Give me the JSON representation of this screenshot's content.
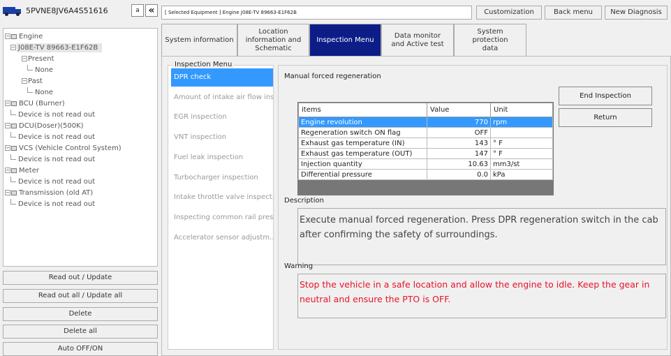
{
  "vehicle": {
    "vin": "5PVNE8JV6A4S51616",
    "btn_small": "a",
    "btn_collapse": "«"
  },
  "tree": [
    {
      "label": "Engine",
      "type": "root"
    },
    {
      "label": "J08E-TV 89663-E1F62B",
      "type": "ecu",
      "selected": true
    },
    {
      "label": "Present",
      "type": "group"
    },
    {
      "label": "None",
      "type": "leaf2"
    },
    {
      "label": "Past",
      "type": "group"
    },
    {
      "label": "None",
      "type": "leaf2"
    },
    {
      "label": "BCU (Burner)",
      "type": "root"
    },
    {
      "label": "Device is not read out",
      "type": "leaf"
    },
    {
      "label": "DCU(Doser)(500K)",
      "type": "root"
    },
    {
      "label": "Device is not read out",
      "type": "leaf"
    },
    {
      "label": "VCS (Vehicle Control System)",
      "type": "root"
    },
    {
      "label": "Device is not read out",
      "type": "leaf"
    },
    {
      "label": "Meter",
      "type": "root"
    },
    {
      "label": "Device is not read out",
      "type": "leaf"
    },
    {
      "label": "Transmission (old AT)",
      "type": "root"
    },
    {
      "label": "Device is not read out",
      "type": "leaf"
    }
  ],
  "left_buttons": {
    "read_out": "Read out / Update",
    "read_out_all": "Read out all / Update all",
    "delete": "Delete",
    "delete_all": "Delete all",
    "auto_off_on": "Auto OFF/ON"
  },
  "header": {
    "selected_equipment": "[ Selected Equipment ] Engine  J08E-TV 89663-E1F62B",
    "customization": "Customization",
    "back_menu": "Back menu",
    "new_diagnosis": "New Diagnosis"
  },
  "tabs": [
    {
      "label": "System information"
    },
    {
      "label": "Location information and Schematic"
    },
    {
      "label": "Inspection Menu",
      "active": true
    },
    {
      "label": "Data monitor and Active test"
    },
    {
      "label": "System protection data"
    }
  ],
  "inspection_menu": {
    "title": "Inspection Menu",
    "items": [
      "DPR check",
      "Amount of intake air flow ins...",
      "EGR inspection",
      "VNT inspection",
      "Fuel leak inspection",
      "Turbocharger inspection",
      "Intake throttle valve inspect...",
      "Inspecting common rail pres...",
      "Accelerator sensor adjustm..."
    ]
  },
  "panel": {
    "title": "Manual forced regeneration",
    "columns": [
      "items",
      "Value",
      "Unit"
    ],
    "rows": [
      {
        "item": "Engine revolution",
        "value": "770",
        "unit": "rpm"
      },
      {
        "item": "Regeneration switch ON flag",
        "value": "OFF",
        "unit": ""
      },
      {
        "item": "Exhaust gas temperature (IN)",
        "value": "143",
        "unit": "° F"
      },
      {
        "item": "Exhaust gas temperature (OUT)",
        "value": "147",
        "unit": "° F"
      },
      {
        "item": "Injection quantity",
        "value": "10.63",
        "unit": "mm3/st"
      },
      {
        "item": "Differential pressure",
        "value": "0.0",
        "unit": "kPa"
      }
    ],
    "end_inspection": "End Inspection",
    "return": "Return",
    "description_label": "Description",
    "description": "Execute manual forced regeneration. Press DPR regeneration switch in the cab after confirming the safety of surroundings.",
    "warning_label": "Warning",
    "warning": "Stop the vehicle in a safe location and allow the engine to idle. Keep the gear in neutral and ensure the PTO is OFF."
  },
  "colors": {
    "accent": "#0d1d87",
    "highlight": "#3399ff",
    "warning": "#e8132a"
  }
}
